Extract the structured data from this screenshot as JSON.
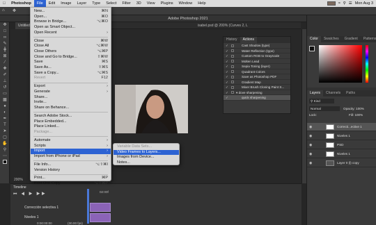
{
  "menubar": {
    "app": "Photoshop",
    "items": [
      "File",
      "Edit",
      "Image",
      "Layer",
      "Type",
      "Select",
      "Filter",
      "3D",
      "View",
      "Plugins",
      "Window",
      "Help"
    ],
    "datetime": "Mon Aug 3"
  },
  "window": {
    "title": "Adobe Photoshop 2021",
    "doc_tab": "Untitled",
    "doc_tab_right": "isabel.psd @ 200% (Curves 2, L",
    "zoom": "200%"
  },
  "file_menu": [
    {
      "label": "New...",
      "shortcut": "⌘N"
    },
    {
      "label": "Open...",
      "shortcut": "⌘O"
    },
    {
      "label": "Browse in Bridge...",
      "shortcut": "⌥⌘O"
    },
    {
      "label": "Open as Smart Object..."
    },
    {
      "label": "Open Recent",
      "arrow": "›"
    },
    {
      "sep": true
    },
    {
      "label": "Close",
      "shortcut": "⌘W"
    },
    {
      "label": "Close All",
      "shortcut": "⌥⌘W"
    },
    {
      "label": "Close Others",
      "shortcut": "⌥⌘P"
    },
    {
      "label": "Close and Go to Bridge...",
      "shortcut": "⇧⌘W"
    },
    {
      "label": "Save",
      "shortcut": "⌘S"
    },
    {
      "label": "Save As...",
      "shortcut": "⇧⌘S"
    },
    {
      "label": "Save a Copy...",
      "shortcut": "⌥⌘S"
    },
    {
      "label": "Revert",
      "shortcut": "F12",
      "disabled": true
    },
    {
      "sep": true
    },
    {
      "label": "Export",
      "arrow": "›"
    },
    {
      "label": "Generate",
      "arrow": "›"
    },
    {
      "label": "Share..."
    },
    {
      "label": "Invite..."
    },
    {
      "label": "Share on Behance..."
    },
    {
      "sep": true
    },
    {
      "label": "Search Adobe Stock..."
    },
    {
      "label": "Place Embedded..."
    },
    {
      "label": "Place Linked..."
    },
    {
      "label": "Package...",
      "disabled": true
    },
    {
      "sep": true
    },
    {
      "label": "Automate",
      "arrow": "›"
    },
    {
      "label": "Scripts",
      "arrow": "›"
    },
    {
      "label": "Import",
      "arrow": "›"
    },
    {
      "label": "Import from iPhone or iPad",
      "arrow": "›"
    },
    {
      "sep": true
    },
    {
      "label": "File Info...",
      "shortcut": "⌥⇧⌘I"
    },
    {
      "label": "Version History"
    },
    {
      "sep": true
    },
    {
      "label": "Print...",
      "shortcut": "⌘P"
    },
    {
      "label": "Print One Copy",
      "shortcut": "⌥⇧⌘P"
    }
  ],
  "import_submenu": [
    {
      "label": "Variable Data Sets...",
      "disabled": true
    },
    {
      "label": "Video Frames to Layers...",
      "highlighted": true
    },
    {
      "label": "Images from Device..."
    },
    {
      "label": "Notes..."
    }
  ],
  "actions_panel": {
    "tabs": [
      "History",
      "Actions"
    ],
    "rows": [
      "Cast Shadow (type)",
      "Water Reflection (type)",
      "Custom RGB to Grayscale",
      "Molten Lead",
      "Sepia Toning (layer)",
      "Quadrant Colors",
      "Save as Photoshop PDF",
      "Gradient Map",
      "Mixer Brush Cloning Paint S...",
      "▾ dove sharpening",
      "quick sharpening"
    ]
  },
  "color_panel": {
    "tabs": [
      "Color",
      "Swatches",
      "Gradient",
      "Patterns"
    ]
  },
  "layers_panel": {
    "tabs": [
      "Layers",
      "Channels",
      "Paths"
    ],
    "kind": "Kind",
    "blend": "Normal",
    "opacity_label": "Opacity:",
    "opacity": "100%",
    "lock_label": "Lock:",
    "fill_label": "Fill:",
    "fill": "100%",
    "layers": [
      {
        "name": "Correcti...ective 1"
      },
      {
        "name": "Niveles 1"
      },
      {
        "name": "PSD"
      },
      {
        "name": "Niveles 1"
      },
      {
        "name": "Layer 0 (l) copy"
      }
    ]
  },
  "timeline": {
    "title": "Timeline",
    "tracks": [
      "Corrección selectiva 1",
      "Niveles 1"
    ],
    "timecode": "0:00:00:00",
    "fps": "(30.00 fps)",
    "marker": "02:00f"
  }
}
